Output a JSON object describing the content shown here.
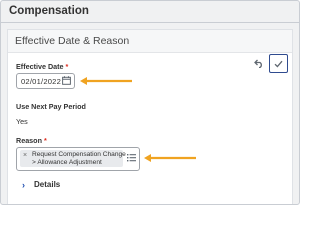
{
  "page": {
    "title": "Compensation"
  },
  "section": {
    "title": "Effective Date & Reason"
  },
  "effective_date": {
    "label": "Effective Date",
    "required_mark": "*",
    "value": "02/01/2022"
  },
  "use_next_pay_period": {
    "label": "Use Next Pay Period",
    "value": "Yes"
  },
  "reason": {
    "label": "Reason",
    "required_mark": "*",
    "selected_line1": "Request Compensation Change",
    "selected_line2": "> Allowance Adjustment",
    "remove_glyph": "×"
  },
  "details": {
    "label": "Details"
  },
  "colors": {
    "arrow": "#f0a321",
    "accent": "#2f4b8f",
    "required": "#de2e21"
  },
  "icons": [
    "calendar-icon",
    "undo-icon",
    "checkmark-icon",
    "list-icon",
    "chevron-right-icon",
    "arrow-left-icon"
  ]
}
